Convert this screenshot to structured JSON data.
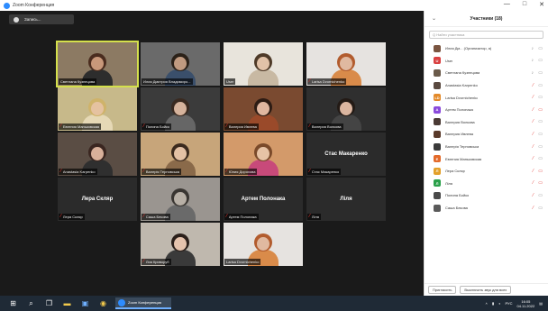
{
  "window": {
    "title": "Zoom Конференция",
    "controls": [
      "—",
      "□",
      "✕"
    ]
  },
  "recording": {
    "label": "Запись..."
  },
  "tiles": [
    {
      "name": "Светлана Кузнецова",
      "muted": false,
      "active": true,
      "skin": "#c8987a",
      "hair": "#4a2c1e",
      "shirt": "#2d2d2d",
      "bg": "#8c7a63"
    },
    {
      "name": "Илия Дмитрия Владимиро...",
      "muted": false,
      "skin": "#c09a80",
      "hair": "#2b2118",
      "shirt": "#3a4f6b",
      "bg": "#6a6a6a"
    },
    {
      "name": "User",
      "muted": false,
      "skin": "#e2c2a8",
      "hair": "#4e3a28",
      "shirt": "#c8b9a3",
      "bg": "#e8e4dc"
    },
    {
      "name": "Larisa Dvornichenko",
      "muted": true,
      "skin": "#e0b9a0",
      "hair": "#b25c2e",
      "shirt": "#d98b4a",
      "bg": "#e6e3e0"
    },
    {
      "name": "Евгения Маньковская",
      "muted": true,
      "skin": "#e5c2a0",
      "hair": "#cfb36a",
      "shirt": "#e6d9b6",
      "bg": "#c7b98a"
    },
    {
      "name": "Полина Бойко",
      "muted": true,
      "skin": "#d6b39c",
      "hair": "#3a2a20",
      "shirt": "#666",
      "bg": "#3b3b3b"
    },
    {
      "name": "Валерия Ивлева",
      "muted": true,
      "skin": "#e0b7a0",
      "hair": "#2d1c14",
      "shirt": "#9a4a2a",
      "bg": "#7a4a30"
    },
    {
      "name": "Валерия Волкова",
      "muted": true,
      "skin": "#dbb6a0",
      "hair": "#231a15",
      "shirt": "#444",
      "bg": "#2f2f2f"
    },
    {
      "name": "Anastasia Karpenko",
      "muted": true,
      "skin": "#d8b09a",
      "hair": "#3a2620",
      "shirt": "#2f2f2f",
      "bg": "#5a4d44"
    },
    {
      "name": "Валерія Терновська",
      "muted": true,
      "skin": "#e3c1a5",
      "hair": "#3b2a1e",
      "shirt": "#8a6a4a",
      "bg": "#c7a57a"
    },
    {
      "name": "Юлия Дороховa",
      "muted": true,
      "skin": "#e6c3a6",
      "hair": "#7a4a2a",
      "shirt": "#c84a7a",
      "bg": "#d39a6a"
    },
    {
      "name": "Стас Макаренко",
      "muted": true,
      "center": "Стас Макаренко"
    },
    {
      "name": "Лера Скляр",
      "muted": true,
      "center": "Лера Скляр"
    },
    {
      "name": "Саша Бекова",
      "muted": true,
      "skin": "#b8b0a6",
      "hair": "#3a3632",
      "shirt": "#6a6a6a",
      "bg": "#9a9590"
    },
    {
      "name": "Артем Полонака",
      "muted": true,
      "center": "Артем Полонака"
    },
    {
      "name": "Ліля",
      "muted": true,
      "center": "Ліля"
    },
    {
      "name": "Лия Криворуб",
      "muted": true,
      "skin": "#e5c3ad",
      "hair": "#2a1f1a",
      "shirt": "#3a3a3a",
      "bg": "#bfb8ae"
    },
    {
      "name": "Larisa Dvornichenko",
      "muted": false,
      "skin": "#e0b9a0",
      "hair": "#b25c2e",
      "shirt": "#d98b4a",
      "bg": "#e6e3e0"
    }
  ],
  "panel": {
    "title": "Участники (18)",
    "search_placeholder": "Q Найти участника",
    "participants": [
      {
        "name": "Илия Дм... (Организатор, я)",
        "color": "#7a5540",
        "initial": "",
        "mic_muted": false,
        "vid_muted": false
      },
      {
        "name": "User",
        "color": "#d94040",
        "initial": "U",
        "mic_muted": false,
        "vid_muted": false
      },
      {
        "name": "Светлана Кузнецова",
        "color": "#6a5a4a",
        "initial": "",
        "mic_muted": false,
        "vid_muted": false
      },
      {
        "name": "Anastasia Karpenko",
        "color": "#5a4a40",
        "initial": "",
        "mic_muted": true,
        "vid_muted": false
      },
      {
        "name": "Larisa Dvornichenko",
        "color": "#e38a2a",
        "initial": "LD",
        "mic_muted": true,
        "vid_muted": false
      },
      {
        "name": "Артем Полонака",
        "color": "#8a4adb",
        "initial": "A",
        "mic_muted": true,
        "vid_muted": true
      },
      {
        "name": "Валерия Волкова",
        "color": "#4a3a34",
        "initial": "",
        "mic_muted": true,
        "vid_muted": false
      },
      {
        "name": "Валерия Ивлева",
        "color": "#5a3a2a",
        "initial": "",
        "mic_muted": true,
        "vid_muted": false
      },
      {
        "name": "Валерія Терновська",
        "color": "#3a3a3a",
        "initial": "",
        "mic_muted": true,
        "vid_muted": false
      },
      {
        "name": "Евгения Маньковская",
        "color": "#e36a2a",
        "initial": "E",
        "mic_muted": true,
        "vid_muted": false
      },
      {
        "name": "Лера Скляр",
        "color": "#e3a02a",
        "initial": "Л",
        "mic_muted": true,
        "vid_muted": true
      },
      {
        "name": "Ліля",
        "color": "#2aa04a",
        "initial": "Л",
        "mic_muted": true,
        "vid_muted": true
      },
      {
        "name": "Полина Бойко",
        "color": "#4a4a4a",
        "initial": "",
        "mic_muted": true,
        "vid_muted": false
      },
      {
        "name": "Саша Бекова",
        "color": "#5a5a5a",
        "initial": "",
        "mic_muted": true,
        "vid_muted": false
      }
    ],
    "invite_label": "Пригласить",
    "mute_all_label": "Выключить звук для всех"
  },
  "taskbar": {
    "zoom_label": "Zoom Конференция",
    "lang": "РУС",
    "time": "16:05",
    "date": "04.11.2022"
  }
}
